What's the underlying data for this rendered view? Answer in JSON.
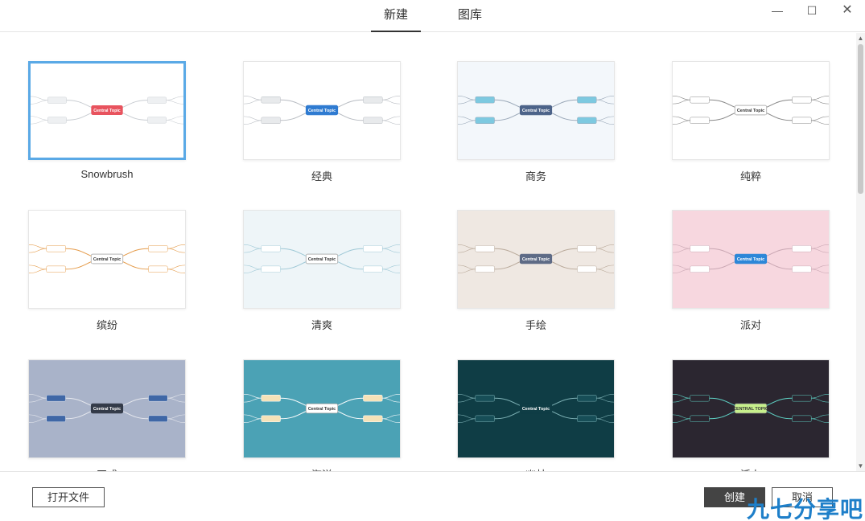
{
  "tabs": [
    {
      "label": "新建",
      "active": true
    },
    {
      "label": "图库",
      "active": false
    }
  ],
  "window_controls": {
    "minimize": "—",
    "maximize": "☐",
    "close": "✕"
  },
  "templates": [
    {
      "name": "Snowbrush",
      "selected": true,
      "bg": "#ffffff",
      "center": "Central Topic",
      "center_color": "#e8535e",
      "node_fill": "#eef0f2",
      "line": "#c9cdd2"
    },
    {
      "name": "经典",
      "selected": false,
      "bg": "#ffffff",
      "center": "Central Topic",
      "center_color": "#2f7bd1",
      "node_fill": "#e8eaec",
      "line": "#b8bcc2"
    },
    {
      "name": "商务",
      "selected": false,
      "bg": "#f3f7fb",
      "center": "Central Topic",
      "center_color": "#4c6389",
      "node_fill": "#7dc9e0",
      "line": "#9aa8b8"
    },
    {
      "name": "纯粹",
      "selected": false,
      "bg": "#ffffff",
      "center": "Central Topic",
      "center_color": "#ffffff",
      "node_fill": "#ffffff",
      "line": "#888888"
    },
    {
      "name": "缤纷",
      "selected": false,
      "bg": "#ffffff",
      "center": "Central Topic",
      "center_color": "#ffffff",
      "node_fill": "#ffffff",
      "line": "#e59b4a"
    },
    {
      "name": "清爽",
      "selected": false,
      "bg": "#eef5f8",
      "center": "Central Topic",
      "center_color": "#ffffff",
      "node_fill": "#ffffff",
      "line": "#9ec8d6"
    },
    {
      "name": "手绘",
      "selected": false,
      "bg": "#efe8e2",
      "center": "Central Topic",
      "center_color": "#5e6b86",
      "node_fill": "#ffffff",
      "line": "#b9a99a"
    },
    {
      "name": "派对",
      "selected": false,
      "bg": "#f7d7df",
      "center": "Central Topic",
      "center_color": "#2d87d8",
      "node_fill": "#ffffff",
      "line": "#c9a7b3"
    },
    {
      "name": "正式",
      "selected": false,
      "bg": "#a9b3c9",
      "center": "Central Topic",
      "center_color": "#333a48",
      "node_fill": "#3f67a6",
      "line": "#e6e8ee"
    },
    {
      "name": "海洋",
      "selected": false,
      "bg": "#4ba2b5",
      "center": "Central Topic",
      "center_color": "#ffffff",
      "node_fill": "#f5e2b8",
      "line": "#ffffff"
    },
    {
      "name": "幽林",
      "selected": false,
      "bg": "#0f3d45",
      "center": "Central Topic",
      "center_color": "#0f3d45",
      "node_fill": "#174e57",
      "line": "#7fb3b7"
    },
    {
      "name": "活力",
      "selected": false,
      "bg": "#2b2630",
      "center": "CENTRAL TOPIC",
      "center_color": "#c7f08c",
      "node_fill": "#2b2630",
      "line": "#5fd3c6"
    }
  ],
  "footer": {
    "open_file": "打开文件",
    "create": "创建",
    "cancel": "取消"
  },
  "watermark": "九七分享吧"
}
